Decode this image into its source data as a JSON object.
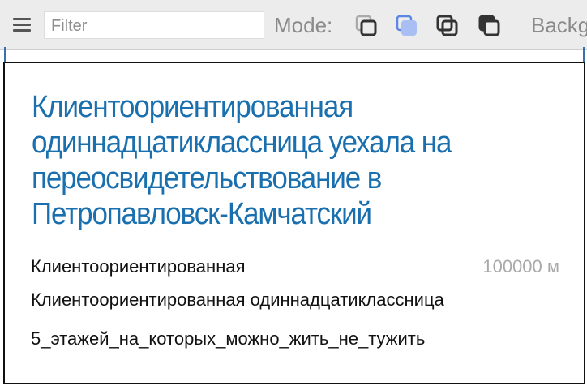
{
  "toolbar": {
    "menu_icon": "hamburger-icon",
    "filter_placeholder": "Filter",
    "filter_value": "",
    "mode_label": "Mode:",
    "modes": [
      {
        "icon": "mode-outline-icon",
        "active": false
      },
      {
        "icon": "mode-filled-icon",
        "active": true
      },
      {
        "icon": "mode-overlap-outline-icon",
        "active": false
      },
      {
        "icon": "mode-overlap-filled-icon",
        "active": false
      }
    ],
    "background_label": "Backg"
  },
  "card": {
    "headline": "Клиентоориентированная одиннадцатиклассница уехала на переосвидетельствование в Петропавловск-Камчатский",
    "line1": "Клиентоориентированная",
    "distance": "100000 м",
    "line2": "Клиентоориентированная одиннадцатиклассница",
    "line3": "5_этажей_на_которых_можно_жить_не_тужить"
  },
  "colors": {
    "headline": "#1a6fae",
    "active_mode": "#7b9ef0",
    "toolbar_bg": "#ececec"
  }
}
